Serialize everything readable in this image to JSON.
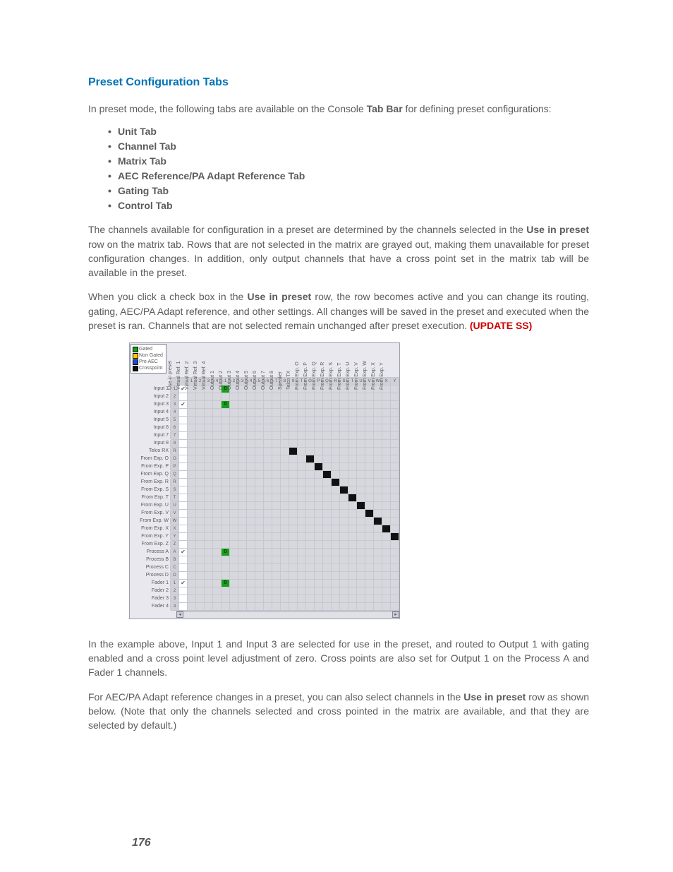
{
  "heading": "Preset Configuration Tabs",
  "intro_a": "In preset mode, the following tabs are available on the Console ",
  "intro_b": "Tab Bar",
  "intro_c": " for defining preset configurations:",
  "tabs_list": [
    "Unit Tab",
    "Channel Tab",
    "Matrix Tab",
    "AEC Reference/PA Adapt Reference Tab",
    "Gating Tab",
    "Control Tab"
  ],
  "para2_a": "The channels available for configuration in a preset are determined by the channels selected in the ",
  "para2_b": "Use in preset",
  "para2_c": " row on the matrix tab. Rows that are not selected in the matrix are grayed out, making them unavailable for preset configuration changes. In addition, only output channels that have a cross point set in the matrix tab will be available in the preset.",
  "para3_a": "When you click a check box in the ",
  "para3_b": "Use in preset",
  "para3_c": " row, the row becomes active and you can change its routing, gating, AEC/PA Adapt reference, and other settings. All changes will be saved in the preset and executed when the preset is ran. Channels that are not selected remain unchanged after preset execution. ",
  "para3_update": "(UPDATE SS)",
  "para4": "In the example above, Input 1 and Input 3 are selected for use in the preset, and routed to Output 1 with gating enabled and a cross point level adjustment of zero. Cross points are also set for Output 1 on the Process A and Fader 1 channels.",
  "para5_a": "For AEC/PA Adapt reference changes in a preset, you can also select channels in the ",
  "para5_b": "Use in preset",
  "para5_c": " row as shown below. (Note that only the channels selected and cross pointed in the matrix are available, and that they are selected by default.)",
  "page_number": "176",
  "legend": {
    "gated": "Gated",
    "nongated": "Non Gated",
    "preaec": "Pre AEC",
    "crosspoint": "Crosspoint"
  },
  "matrix": {
    "col_headers": [
      "Use in preset",
      "Virtual Ref. 1",
      "Virtual Ref. 2",
      "Virtual Ref. 3",
      "Virtual Ref. 4",
      "Output 1",
      "Output 2",
      "Output 3",
      "Output 4",
      "Output 5",
      "Output 6",
      "Output 7",
      "Output 8",
      "Speaker",
      "Telco TX",
      "From Exp. O",
      "From Exp. P",
      "From Exp. Q",
      "From Exp. R",
      "From Exp. S",
      "From Exp. T",
      "From Exp. U",
      "From Exp. V",
      "From Exp. W",
      "From Exp. X",
      "From Exp. Y"
    ],
    "col_numbers": [
      "",
      "1",
      "2",
      "3",
      "4",
      "1",
      "2",
      "3",
      "4",
      "5",
      "6",
      "7",
      "8",
      "9",
      "T",
      "O",
      "P",
      "Q",
      "R",
      "S",
      "T",
      "U",
      "V",
      "W",
      "X",
      "Y"
    ],
    "rows": [
      {
        "label": "Input 1",
        "num": "1",
        "use": true,
        "points": [
          {
            "col": 5,
            "type": "green",
            "val": "0"
          }
        ]
      },
      {
        "label": "Input 2",
        "num": "2",
        "use": false,
        "points": []
      },
      {
        "label": "Input 3",
        "num": "3",
        "use": true,
        "points": [
          {
            "col": 5,
            "type": "green",
            "val": "0"
          }
        ]
      },
      {
        "label": "Input 4",
        "num": "4",
        "use": false,
        "points": []
      },
      {
        "label": "Input 5",
        "num": "5",
        "use": false,
        "points": []
      },
      {
        "label": "Input 6",
        "num": "6",
        "use": false,
        "points": []
      },
      {
        "label": "Input 7",
        "num": "7",
        "use": false,
        "points": []
      },
      {
        "label": "Input 8",
        "num": "8",
        "use": false,
        "points": []
      },
      {
        "label": "Telco RX",
        "num": "R",
        "use": false,
        "points": [
          {
            "col": 13,
            "type": "dark"
          }
        ]
      },
      {
        "label": "From Exp. O",
        "num": "O",
        "use": false,
        "points": [
          {
            "col": 15,
            "type": "dark"
          }
        ]
      },
      {
        "label": "From Exp. P",
        "num": "P",
        "use": false,
        "points": [
          {
            "col": 16,
            "type": "dark"
          }
        ]
      },
      {
        "label": "From Exp. Q",
        "num": "Q",
        "use": false,
        "points": [
          {
            "col": 17,
            "type": "dark"
          }
        ]
      },
      {
        "label": "From Exp. R",
        "num": "R",
        "use": false,
        "points": [
          {
            "col": 18,
            "type": "dark"
          }
        ]
      },
      {
        "label": "From Exp. S",
        "num": "S",
        "use": false,
        "points": [
          {
            "col": 19,
            "type": "dark"
          }
        ]
      },
      {
        "label": "From Exp. T",
        "num": "T",
        "use": false,
        "points": [
          {
            "col": 20,
            "type": "dark"
          }
        ]
      },
      {
        "label": "From Exp. U",
        "num": "U",
        "use": false,
        "points": [
          {
            "col": 21,
            "type": "dark"
          }
        ]
      },
      {
        "label": "From Exp. V",
        "num": "V",
        "use": false,
        "points": [
          {
            "col": 22,
            "type": "dark"
          }
        ]
      },
      {
        "label": "From Exp. W",
        "num": "W",
        "use": false,
        "points": [
          {
            "col": 23,
            "type": "dark"
          }
        ]
      },
      {
        "label": "From Exp. X",
        "num": "X",
        "use": false,
        "points": [
          {
            "col": 24,
            "type": "dark"
          }
        ]
      },
      {
        "label": "From Exp. Y",
        "num": "Y",
        "use": false,
        "points": [
          {
            "col": 25,
            "type": "dark"
          }
        ]
      },
      {
        "label": "From Exp. Z",
        "num": "Z",
        "use": false,
        "points": []
      },
      {
        "label": "Process A",
        "num": "A",
        "use": true,
        "points": [
          {
            "col": 5,
            "type": "green",
            "val": "0"
          }
        ]
      },
      {
        "label": "Process B",
        "num": "B",
        "use": false,
        "points": []
      },
      {
        "label": "Process C",
        "num": "C",
        "use": false,
        "points": []
      },
      {
        "label": "Process D",
        "num": "D",
        "use": false,
        "points": []
      },
      {
        "label": "Fader 1",
        "num": "1",
        "use": true,
        "points": [
          {
            "col": 5,
            "type": "green",
            "val": "0"
          }
        ]
      },
      {
        "label": "Fader 2",
        "num": "2",
        "use": false,
        "points": []
      },
      {
        "label": "Fader 3",
        "num": "3",
        "use": false,
        "points": []
      },
      {
        "label": "Fader 4",
        "num": "4",
        "use": false,
        "points": []
      }
    ]
  }
}
